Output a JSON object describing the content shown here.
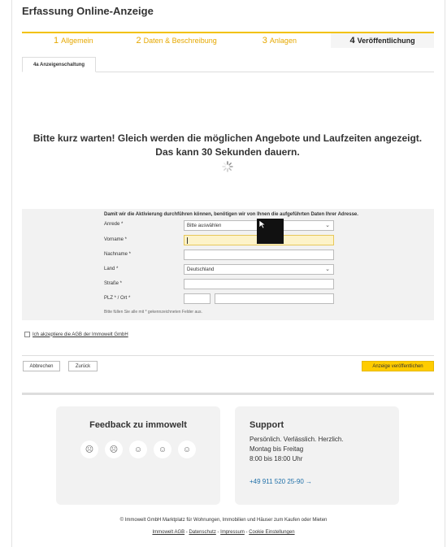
{
  "page_title": "Erfassung Online-Anzeige",
  "steps": [
    {
      "num": "1",
      "label": "Allgemein"
    },
    {
      "num": "2",
      "label": "Daten & Beschreibung"
    },
    {
      "num": "3",
      "label": "Anlagen"
    },
    {
      "num": "4",
      "label": "Veröffentlichung"
    }
  ],
  "tab_label": "4a Anzeigenschaltung",
  "wait_message": "Bitte kurz warten! Gleich werden die möglichen Angebote und Laufzeiten angezeigt. Das kann 30 Sekunden dauern.",
  "form": {
    "hint": "Damit wir die Aktivierung durchführen können, benötigen wir von Ihnen die aufgeführten Daten Ihrer Adresse.",
    "anrede_label": "Anrede *",
    "anrede_value": "Bitte auswählen",
    "vorname_label": "Vorname *",
    "nachname_label": "Nachname *",
    "land_label": "Land *",
    "land_value": "Deutschland",
    "strasse_label": "Straße *",
    "plz_ort_label": "PLZ * / Ort *",
    "note": "Bitte füllen Sie alle mit * gekennzeichneten Felder aus."
  },
  "agb_text": "Ich akzeptiere die AGB der Immowelt GmbH",
  "buttons": {
    "cancel": "Abbrechen",
    "back": "Zurück",
    "publish": "Anzeige veröffentlichen"
  },
  "feedback": {
    "title": "Feedback zu immowelt",
    "faces": [
      "☹",
      "☹",
      "☺",
      "☺",
      "☺"
    ]
  },
  "support": {
    "title": "Support",
    "line1": "Persönlich. Verlässlich. Herzlich.",
    "line2": "Montag bis Freitag",
    "line3": "8:00 bis 18:00 Uhr",
    "phone": "+49 911 520 25-90 →"
  },
  "footer": {
    "copyright": "© Immowelt GmbH Marktplatz für Wohnungen, Immobilien und Häuser zum Kaufen oder Mieten",
    "links": [
      "Immowelt AGB",
      "Datenschutz",
      "Impressum",
      "Cookie Einstellungen"
    ],
    "separator": " - "
  },
  "colors": {
    "accent": "#ffcc00",
    "step_text": "#e6a800",
    "link": "#1e6fa8"
  }
}
